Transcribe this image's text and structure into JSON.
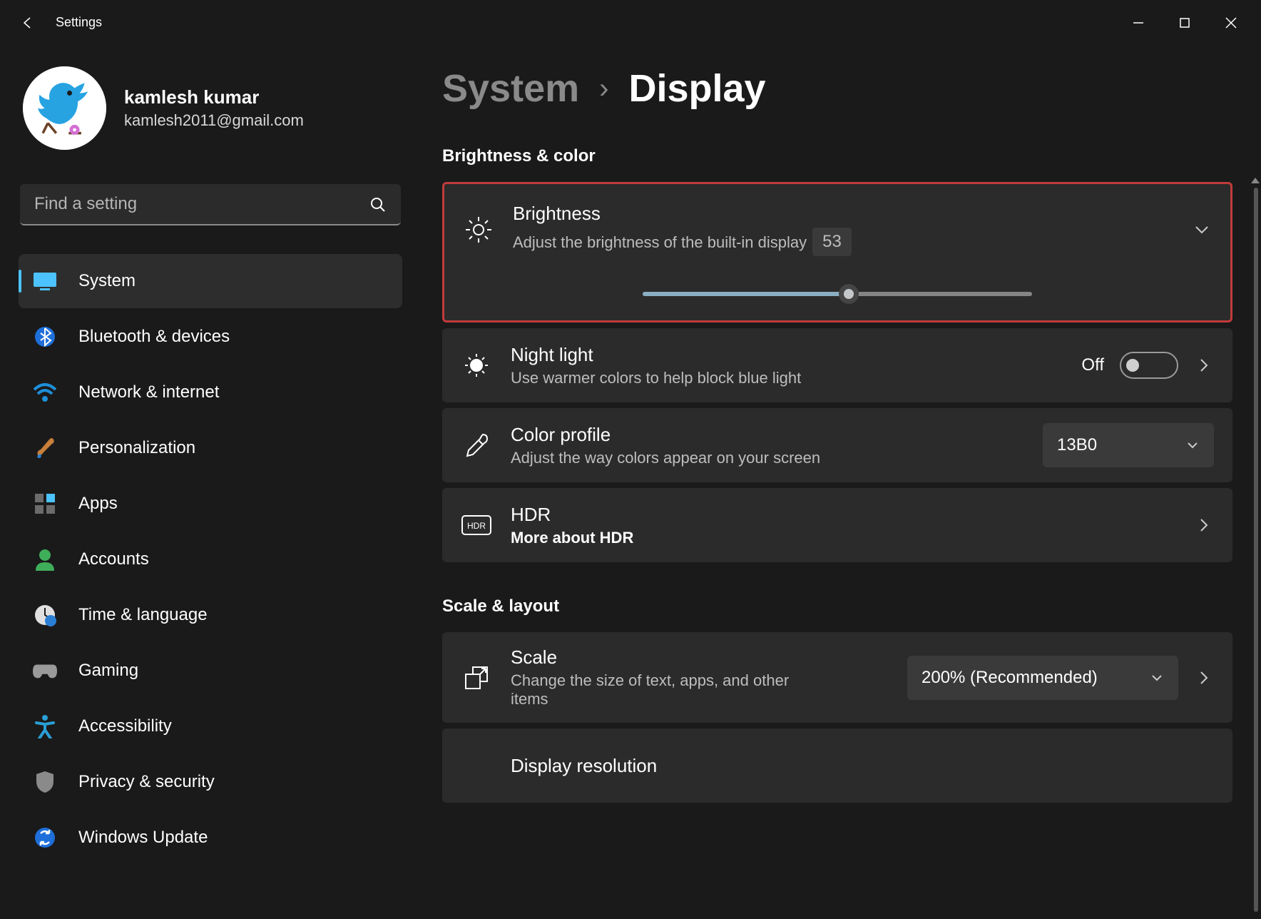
{
  "app_title": "Settings",
  "user": {
    "name": "kamlesh kumar",
    "email": "kamlesh2011@gmail.com"
  },
  "search": {
    "placeholder": "Find a setting"
  },
  "nav": [
    {
      "label": "System"
    },
    {
      "label": "Bluetooth & devices"
    },
    {
      "label": "Network & internet"
    },
    {
      "label": "Personalization"
    },
    {
      "label": "Apps"
    },
    {
      "label": "Accounts"
    },
    {
      "label": "Time & language"
    },
    {
      "label": "Gaming"
    },
    {
      "label": "Accessibility"
    },
    {
      "label": "Privacy & security"
    },
    {
      "label": "Windows Update"
    }
  ],
  "breadcrumb": {
    "parent": "System",
    "current": "Display"
  },
  "sections": {
    "s1": "Brightness & color",
    "s2": "Scale & layout"
  },
  "brightness": {
    "title": "Brightness",
    "desc": "Adjust the brightness of the built-in display",
    "value": "53"
  },
  "nightlight": {
    "title": "Night light",
    "desc": "Use warmer colors to help block blue light",
    "state": "Off"
  },
  "colorprofile": {
    "title": "Color profile",
    "desc": "Adjust the way colors appear on your screen",
    "selected": "13B0"
  },
  "hdr": {
    "title": "HDR",
    "desc": "More about HDR"
  },
  "scale": {
    "title": "Scale",
    "desc": "Change the size of text, apps, and other items",
    "selected": "200% (Recommended)"
  },
  "resolution": {
    "title": "Display resolution"
  }
}
